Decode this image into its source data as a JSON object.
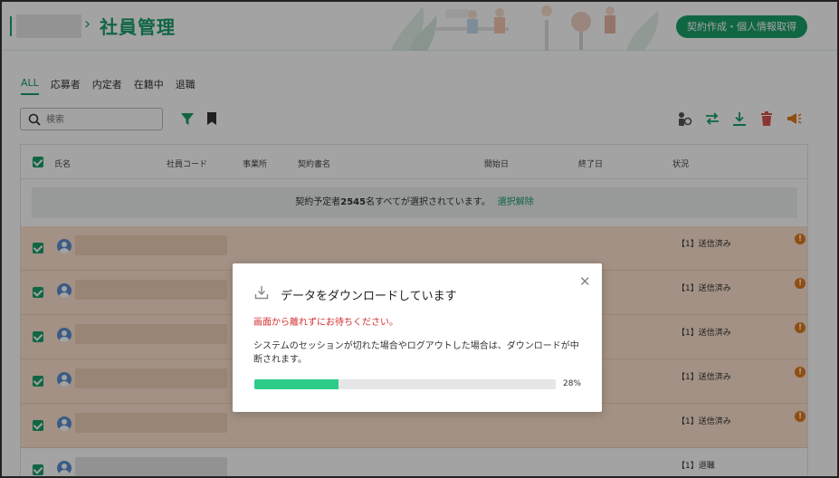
{
  "header": {
    "title": "社員管理",
    "action_button": "契約作成・個人情報取得"
  },
  "tabs": [
    {
      "label": "ALL",
      "active": true
    },
    {
      "label": "応募者",
      "active": false
    },
    {
      "label": "内定者",
      "active": false
    },
    {
      "label": "在籍中",
      "active": false
    },
    {
      "label": "退職",
      "active": false
    }
  ],
  "search": {
    "placeholder": "検索"
  },
  "toolbar_icons": [
    "filter-icon",
    "bookmark-icon",
    "user-settings-icon",
    "swap-icon",
    "download-icon",
    "trash-icon",
    "megaphone-icon"
  ],
  "table": {
    "columns": [
      "氏名",
      "社員コード",
      "事業所",
      "契約書名",
      "開始日",
      "終了日",
      "状況"
    ],
    "banner": {
      "prefix": "契約予定者",
      "count": "2545",
      "suffix": "名すべてが選択されています。",
      "clear_link": "選択解除"
    },
    "rows": [
      {
        "status": "【1】送信済み"
      },
      {
        "status": "【1】送信済み"
      },
      {
        "status": "【1】送信済み"
      },
      {
        "status": "【1】送信済み"
      },
      {
        "status": "【1】送信済み"
      },
      {
        "status": "【1】退職"
      }
    ]
  },
  "modal": {
    "title": "データをダウンロードしています",
    "warning": "画面から離れずにお待ちください。",
    "description": "システムのセッションが切れた場合やログアウトした場合は、ダウンロードが中断されます。",
    "progress": 0.28,
    "progress_label": "28%"
  },
  "colors": {
    "accent": "#1aa06a",
    "warn": "#e07b1c",
    "danger": "#d32f2f",
    "progress": "#2ecc89"
  }
}
